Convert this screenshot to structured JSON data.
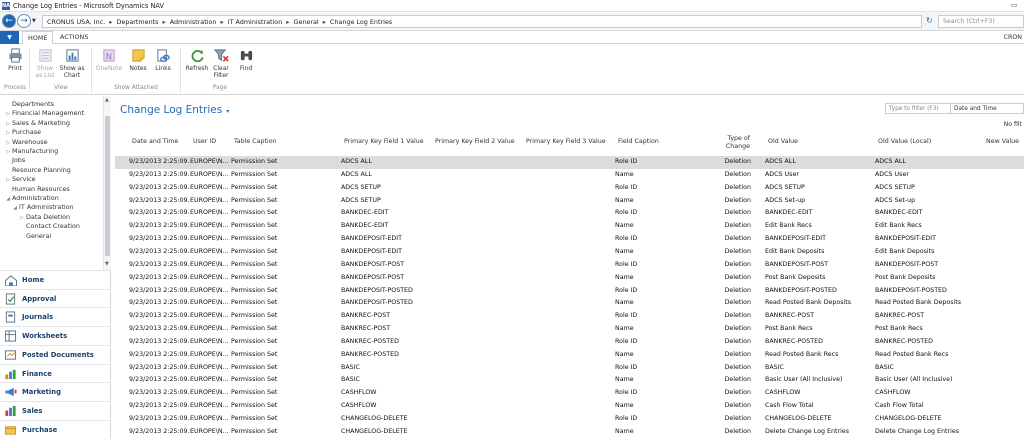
{
  "window": {
    "title": "Change Log Entries - Microsoft Dynamics NAV",
    "app_icon": "NAV",
    "minimize": "▭"
  },
  "address": {
    "crumbs": [
      "CRONUS USA, Inc.",
      "Departments",
      "Administration",
      "IT Administration",
      "General",
      "Change Log Entries"
    ],
    "search_placeholder": "Search (Ctrl+F3)"
  },
  "ribbon_tabs": {
    "home": "HOME",
    "actions": "ACTIONS",
    "company": "CRON"
  },
  "ribbon": {
    "print": "Print",
    "show_as_list": "Show as List",
    "show_as_chart": "Show as Chart",
    "onenote": "OneNote",
    "notes": "Notes",
    "links": "Links",
    "refresh": "Refresh",
    "clear_filter": "Clear Filter",
    "find": "Find",
    "groups": {
      "process": "Process",
      "view": "View",
      "show_attached": "Show Attached",
      "page": "Page"
    }
  },
  "sidebar": {
    "tree": [
      {
        "label": "Departments",
        "arrow": "",
        "indent": 0
      },
      {
        "label": "Financial Management",
        "arrow": "▷",
        "indent": 0
      },
      {
        "label": "Sales & Marketing",
        "arrow": "▷",
        "indent": 0
      },
      {
        "label": "Purchase",
        "arrow": "▷",
        "indent": 0
      },
      {
        "label": "Warehouse",
        "arrow": "▷",
        "indent": 0
      },
      {
        "label": "Manufacturing",
        "arrow": "▷",
        "indent": 0
      },
      {
        "label": "Jobs",
        "arrow": "",
        "indent": 0
      },
      {
        "label": "Resource Planning",
        "arrow": "",
        "indent": 0
      },
      {
        "label": "Service",
        "arrow": "▷",
        "indent": 0
      },
      {
        "label": "Human Resources",
        "arrow": "",
        "indent": 0
      },
      {
        "label": "Administration",
        "arrow": "◢",
        "indent": 0
      },
      {
        "label": "IT Administration",
        "arrow": "◢",
        "indent": 1
      },
      {
        "label": "Data Deletion",
        "arrow": "▷",
        "indent": 2
      },
      {
        "label": "Contact Creation",
        "arrow": "",
        "indent": 2
      },
      {
        "label": "General",
        "arrow": "",
        "indent": 2
      }
    ],
    "nav_buttons": [
      {
        "label": "Home",
        "icon": "home-icon"
      },
      {
        "label": "Approval",
        "icon": "approval-icon"
      },
      {
        "label": "Journals",
        "icon": "journals-icon"
      },
      {
        "label": "Worksheets",
        "icon": "worksheets-icon"
      },
      {
        "label": "Posted Documents",
        "icon": "posted-documents-icon"
      },
      {
        "label": "Finance",
        "icon": "finance-icon"
      },
      {
        "label": "Marketing",
        "icon": "marketing-icon"
      },
      {
        "label": "Sales",
        "icon": "sales-icon"
      },
      {
        "label": "Purchase",
        "icon": "purchase-icon"
      }
    ]
  },
  "page": {
    "title": "Change Log Entries",
    "title_dropdown": "▾",
    "filter_placeholder": "Type to filter (F3)",
    "filter_field": "Date and Time",
    "no_filter": "No filt"
  },
  "table": {
    "headers": {
      "date_time": "Date and Time",
      "user_id": "User ID",
      "table_caption": "Table Caption",
      "pk1": "Primary Key Field 1 Value",
      "pk2": "Primary Key Field 2 Value",
      "pk3": "Primary Key Field 3 Value",
      "field_caption": "Field Caption",
      "type_of_change": "Type of Change",
      "old_value": "Old Value",
      "old_value_local": "Old Value (Local)",
      "new_value": "New Value"
    },
    "rows": [
      [
        "9/23/2013 2:25:09...",
        "EUROPE\\N...",
        "Permission Set",
        "ADCS ALL",
        "Role ID",
        "Deletion",
        "ADCS ALL",
        "ADCS ALL"
      ],
      [
        "9/23/2013 2:25:09...",
        "EUROPE\\N...",
        "Permission Set",
        "ADCS ALL",
        "Name",
        "Deletion",
        "ADCS User",
        "ADCS User"
      ],
      [
        "9/23/2013 2:25:09...",
        "EUROPE\\N...",
        "Permission Set",
        "ADCS SETUP",
        "Role ID",
        "Deletion",
        "ADCS SETUP",
        "ADCS SETUP"
      ],
      [
        "9/23/2013 2:25:09...",
        "EUROPE\\N...",
        "Permission Set",
        "ADCS SETUP",
        "Name",
        "Deletion",
        "ADCS Set-up",
        "ADCS Set-up"
      ],
      [
        "9/23/2013 2:25:09...",
        "EUROPE\\N...",
        "Permission Set",
        "BANKDEC-EDIT",
        "Role ID",
        "Deletion",
        "BANKDEC-EDIT",
        "BANKDEC-EDIT"
      ],
      [
        "9/23/2013 2:25:09...",
        "EUROPE\\N...",
        "Permission Set",
        "BANKDEC-EDIT",
        "Name",
        "Deletion",
        "Edit Bank Recs",
        "Edit Bank Recs"
      ],
      [
        "9/23/2013 2:25:09...",
        "EUROPE\\N...",
        "Permission Set",
        "BANKDEPOSIT-EDIT",
        "Role ID",
        "Deletion",
        "BANKDEPOSIT-EDIT",
        "BANKDEPOSIT-EDIT"
      ],
      [
        "9/23/2013 2:25:09...",
        "EUROPE\\N...",
        "Permission Set",
        "BANKDEPOSIT-EDIT",
        "Name",
        "Deletion",
        "Edit Bank Deposits",
        "Edit Bank Deposits"
      ],
      [
        "9/23/2013 2:25:09...",
        "EUROPE\\N...",
        "Permission Set",
        "BANKDEPOSIT-POST",
        "Role ID",
        "Deletion",
        "BANKDEPOSIT-POST",
        "BANKDEPOSIT-POST"
      ],
      [
        "9/23/2013 2:25:09...",
        "EUROPE\\N...",
        "Permission Set",
        "BANKDEPOSIT-POST",
        "Name",
        "Deletion",
        "Post Bank Deposits",
        "Post Bank Deposits"
      ],
      [
        "9/23/2013 2:25:09...",
        "EUROPE\\N...",
        "Permission Set",
        "BANKDEPOSIT-POSTED",
        "Role ID",
        "Deletion",
        "BANKDEPOSIT-POSTED",
        "BANKDEPOSIT-POSTED"
      ],
      [
        "9/23/2013 2:25:09...",
        "EUROPE\\N...",
        "Permission Set",
        "BANKDEPOSIT-POSTED",
        "Name",
        "Deletion",
        "Read Posted Bank Deposits",
        "Read Posted Bank Deposits"
      ],
      [
        "9/23/2013 2:25:09...",
        "EUROPE\\N...",
        "Permission Set",
        "BANKREC-POST",
        "Role ID",
        "Deletion",
        "BANKREC-POST",
        "BANKREC-POST"
      ],
      [
        "9/23/2013 2:25:09...",
        "EUROPE\\N...",
        "Permission Set",
        "BANKREC-POST",
        "Name",
        "Deletion",
        "Post Bank Recs",
        "Post Bank Recs"
      ],
      [
        "9/23/2013 2:25:09...",
        "EUROPE\\N...",
        "Permission Set",
        "BANKREC-POSTED",
        "Role ID",
        "Deletion",
        "BANKREC-POSTED",
        "BANKREC-POSTED"
      ],
      [
        "9/23/2013 2:25:09...",
        "EUROPE\\N...",
        "Permission Set",
        "BANKREC-POSTED",
        "Name",
        "Deletion",
        "Read Posted Bank Recs",
        "Read Posted Bank Recs"
      ],
      [
        "9/23/2013 2:25:09...",
        "EUROPE\\N...",
        "Permission Set",
        "BASIC",
        "Role ID",
        "Deletion",
        "BASIC",
        "BASIC"
      ],
      [
        "9/23/2013 2:25:09...",
        "EUROPE\\N...",
        "Permission Set",
        "BASIC",
        "Name",
        "Deletion",
        "Basic User (All Inclusive)",
        "Basic User (All Inclusive)"
      ],
      [
        "9/23/2013 2:25:09...",
        "EUROPE\\N...",
        "Permission Set",
        "CASHFLOW",
        "Role ID",
        "Deletion",
        "CASHFLOW",
        "CASHFLOW"
      ],
      [
        "9/23/2013 2:25:09...",
        "EUROPE\\N...",
        "Permission Set",
        "CASHFLOW",
        "Name",
        "Deletion",
        "Cash Flow Total",
        "Cash Flow Total"
      ],
      [
        "9/23/2013 2:25:09...",
        "EUROPE\\N...",
        "Permission Set",
        "CHANGELOG-DELETE",
        "Role ID",
        "Deletion",
        "CHANGELOG-DELETE",
        "CHANGELOG-DELETE"
      ],
      [
        "9/23/2013 2:25:09...",
        "EUROPE\\N...",
        "Permission Set",
        "CHANGELOG-DELETE",
        "Name",
        "Deletion",
        "Delete Change Log Entries",
        "Delete Change Log Entries"
      ]
    ],
    "selected_row": 0
  },
  "colors": {
    "accent": "#1f6bb8",
    "selected_row": "#dcdcdc",
    "nav_text": "#1b3f6e"
  }
}
